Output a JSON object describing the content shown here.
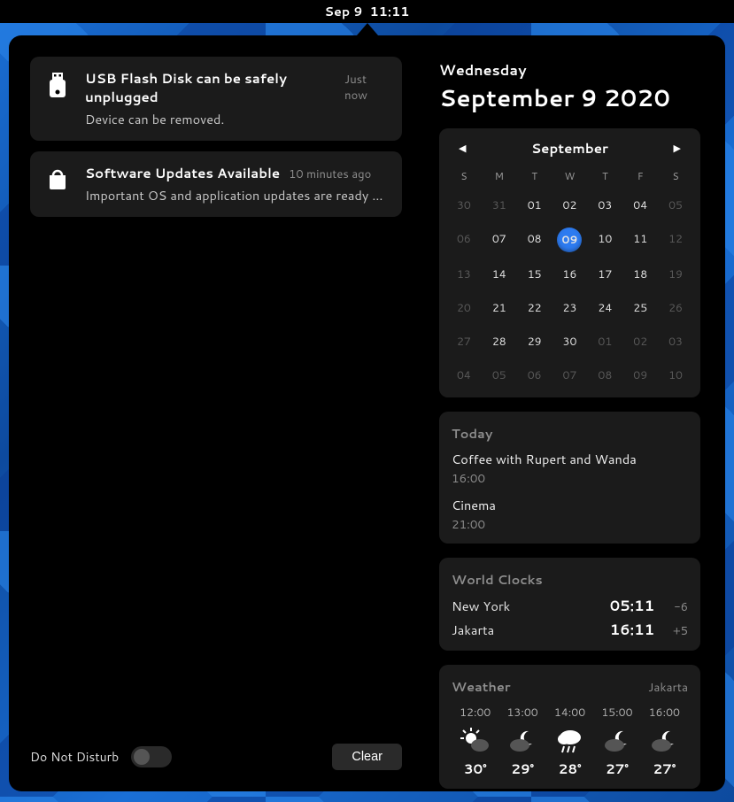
{
  "topbar": {
    "date": "Sep 9",
    "time": "11:11"
  },
  "notifications": [
    {
      "title": "USB Flash Disk can be safely unplugged",
      "time": "Just now",
      "desc": "Device can be removed.",
      "icon": "usb"
    },
    {
      "title": "Software Updates Available",
      "time": "10 minutes ago",
      "desc": "Important OS and application updates are ready to …",
      "icon": "package"
    }
  ],
  "dnd_label": "Do Not Disturb",
  "clear_label": "Clear",
  "header": {
    "weekday": "Wednesday",
    "full_date": "September 9 2020"
  },
  "calendar": {
    "month": "September",
    "dow": [
      "S",
      "M",
      "T",
      "W",
      "T",
      "F",
      "S"
    ],
    "weeks": [
      [
        {
          "n": "30",
          "dim": true
        },
        {
          "n": "31",
          "dim": true
        },
        {
          "n": "01"
        },
        {
          "n": "02"
        },
        {
          "n": "03"
        },
        {
          "n": "04"
        },
        {
          "n": "05",
          "dim": true
        }
      ],
      [
        {
          "n": "06",
          "dim": true
        },
        {
          "n": "07"
        },
        {
          "n": "08"
        },
        {
          "n": "09",
          "today": true
        },
        {
          "n": "10"
        },
        {
          "n": "11"
        },
        {
          "n": "12",
          "dim": true
        }
      ],
      [
        {
          "n": "13",
          "dim": true
        },
        {
          "n": "14"
        },
        {
          "n": "15"
        },
        {
          "n": "16"
        },
        {
          "n": "17"
        },
        {
          "n": "18"
        },
        {
          "n": "19",
          "dim": true
        }
      ],
      [
        {
          "n": "20",
          "dim": true
        },
        {
          "n": "21"
        },
        {
          "n": "22"
        },
        {
          "n": "23"
        },
        {
          "n": "24"
        },
        {
          "n": "25"
        },
        {
          "n": "26",
          "dim": true
        }
      ],
      [
        {
          "n": "27",
          "dim": true
        },
        {
          "n": "28"
        },
        {
          "n": "29"
        },
        {
          "n": "30"
        },
        {
          "n": "01",
          "dim": true
        },
        {
          "n": "02",
          "dim": true
        },
        {
          "n": "03",
          "dim": true
        }
      ],
      [
        {
          "n": "04",
          "dim": true
        },
        {
          "n": "05",
          "dim": true
        },
        {
          "n": "06",
          "dim": true
        },
        {
          "n": "07",
          "dim": true
        },
        {
          "n": "08",
          "dim": true
        },
        {
          "n": "09",
          "dim": true
        },
        {
          "n": "10",
          "dim": true
        }
      ]
    ]
  },
  "events": {
    "heading": "Today",
    "items": [
      {
        "title": "Coffee with Rupert and Wanda",
        "time": "16:00"
      },
      {
        "title": "Cinema",
        "time": "21:00"
      }
    ]
  },
  "world_clocks": {
    "heading": "World Clocks",
    "items": [
      {
        "city": "New York",
        "time": "05:11",
        "offset": "-6"
      },
      {
        "city": "Jakarta",
        "time": "16:11",
        "offset": "+5"
      }
    ]
  },
  "weather": {
    "heading": "Weather",
    "location": "Jakarta",
    "forecast": [
      {
        "hour": "12:00",
        "icon": "partly-sunny",
        "temp": "30°"
      },
      {
        "hour": "13:00",
        "icon": "mostly-cloudy-night",
        "temp": "29°"
      },
      {
        "hour": "14:00",
        "icon": "rain",
        "temp": "28°"
      },
      {
        "hour": "15:00",
        "icon": "mostly-cloudy-night",
        "temp": "27°"
      },
      {
        "hour": "16:00",
        "icon": "mostly-cloudy-night",
        "temp": "27°"
      }
    ]
  }
}
